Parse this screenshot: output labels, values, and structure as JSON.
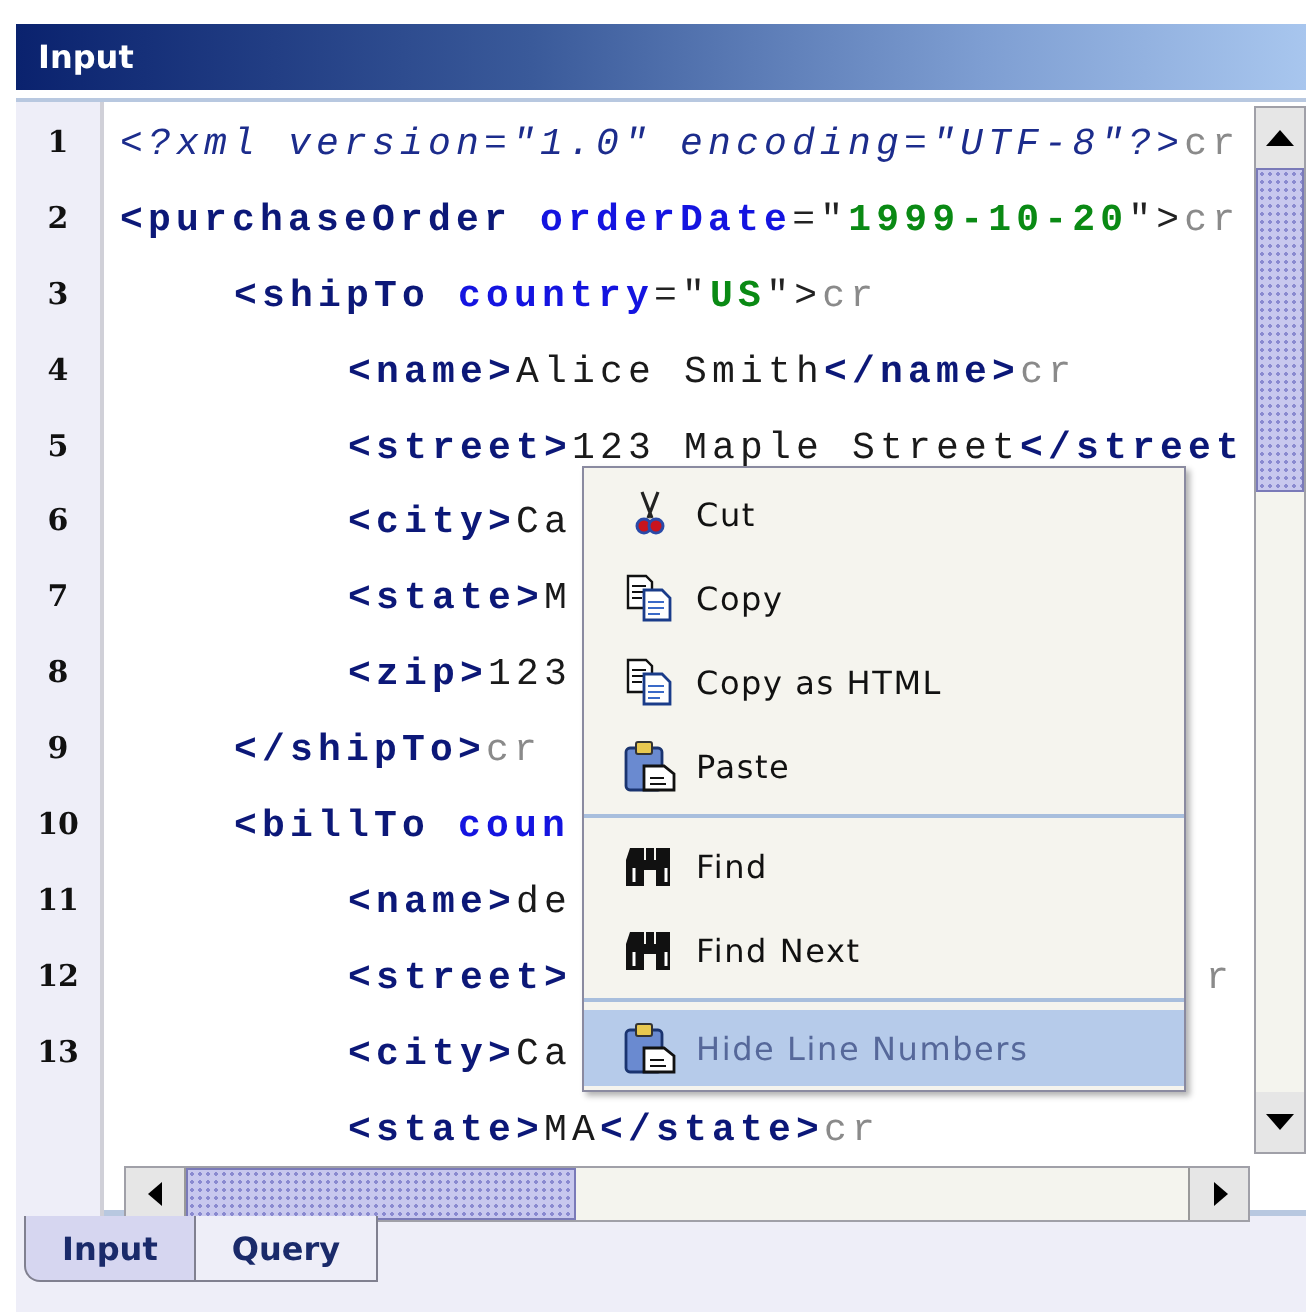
{
  "panel": {
    "title": "Input"
  },
  "line_numbers": [
    "1",
    "2",
    "3",
    "4",
    "5",
    "6",
    "7",
    "8",
    "9",
    "10",
    "11",
    "12",
    "13"
  ],
  "code": [
    {
      "segments": [
        {
          "kind": "pi",
          "text": "<?xml version=\"1.0\" encoding=\"UTF-8\"?>"
        },
        {
          "kind": "cr",
          "text": "cr"
        }
      ]
    },
    {
      "segments": [
        {
          "kind": "tag",
          "text": "<purchaseOrder"
        },
        {
          "kind": "attr",
          "text": "orderDate"
        },
        {
          "kind": "punct",
          "text": "=\""
        },
        {
          "kind": "value",
          "text": "1999-10-20"
        },
        {
          "kind": "punct",
          "text": "\">"
        },
        {
          "kind": "cr",
          "text": "cr"
        }
      ],
      "children": [
        {
          "segments": [
            {
              "kind": "tag",
              "text": "<shipTo"
            },
            {
              "kind": "attr",
              "text": "country"
            },
            {
              "kind": "punct",
              "text": "=\""
            },
            {
              "kind": "value",
              "text": "US"
            },
            {
              "kind": "punct",
              "text": "\">"
            },
            {
              "kind": "cr",
              "text": "cr"
            }
          ],
          "children": [
            {
              "segments": [
                {
                  "kind": "tag",
                  "text": "<name>"
                },
                {
                  "kind": "text",
                  "text": "Alice Smith"
                },
                {
                  "kind": "tag",
                  "text": "</name>"
                },
                {
                  "kind": "cr",
                  "text": "cr"
                }
              ]
            },
            {
              "segments": [
                {
                  "kind": "tag",
                  "text": "<street>"
                },
                {
                  "kind": "text",
                  "text": "123 Maple Street"
                },
                {
                  "kind": "tag",
                  "text": "</street"
                }
              ]
            },
            {
              "segments": [
                {
                  "kind": "tag",
                  "text": "<city>"
                },
                {
                  "kind": "text",
                  "text": "Ca"
                }
              ]
            },
            {
              "segments": [
                {
                  "kind": "tag",
                  "text": "<state>"
                },
                {
                  "kind": "text",
                  "text": "M"
                }
              ]
            },
            {
              "segments": [
                {
                  "kind": "tag",
                  "text": "<zip>"
                },
                {
                  "kind": "text",
                  "text": "123"
                }
              ]
            }
          ]
        },
        {
          "segments": [
            {
              "kind": "tag",
              "text": "</shipTo>"
            },
            {
              "kind": "cr",
              "text": "cr"
            }
          ]
        },
        {
          "segments": [
            {
              "kind": "tag",
              "text": "<billTo"
            },
            {
              "kind": "attr",
              "text": "coun"
            }
          ],
          "children": [
            {
              "segments": [
                {
                  "kind": "tag",
                  "text": "<name>"
                },
                {
                  "kind": "text",
                  "text": "de"
                }
              ]
            },
            {
              "segments": [
                {
                  "kind": "tag",
                  "text": "<street>"
                }
              ],
              "tail": "r"
            },
            {
              "segments": [
                {
                  "kind": "tag",
                  "text": "<city>"
                },
                {
                  "kind": "text",
                  "text": "Ca"
                }
              ]
            },
            {
              "segments": [
                {
                  "kind": "tag",
                  "text": "<state>"
                },
                {
                  "kind": "text",
                  "text": "MA"
                },
                {
                  "kind": "tag",
                  "text": "</state>"
                },
                {
                  "kind": "cr",
                  "text": "cr"
                }
              ]
            }
          ]
        }
      ]
    }
  ],
  "context_menu": {
    "groups": [
      {
        "items": [
          {
            "kind": "cut",
            "label": "Cut",
            "selected": false
          },
          {
            "kind": "copy",
            "label": "Copy",
            "selected": false
          },
          {
            "kind": "copy",
            "label": "Copy as HTML",
            "selected": false
          },
          {
            "kind": "paste",
            "label": "Paste",
            "selected": false
          }
        ]
      },
      {
        "items": [
          {
            "kind": "find",
            "label": "Find",
            "selected": false
          },
          {
            "kind": "find",
            "label": "Find Next",
            "selected": false
          }
        ]
      },
      {
        "items": [
          {
            "kind": "paste",
            "label": "Hide Line Numbers",
            "selected": true
          }
        ]
      }
    ]
  },
  "tabs": [
    {
      "label": "Input",
      "selected": true
    },
    {
      "label": "Query",
      "selected": false
    }
  ]
}
